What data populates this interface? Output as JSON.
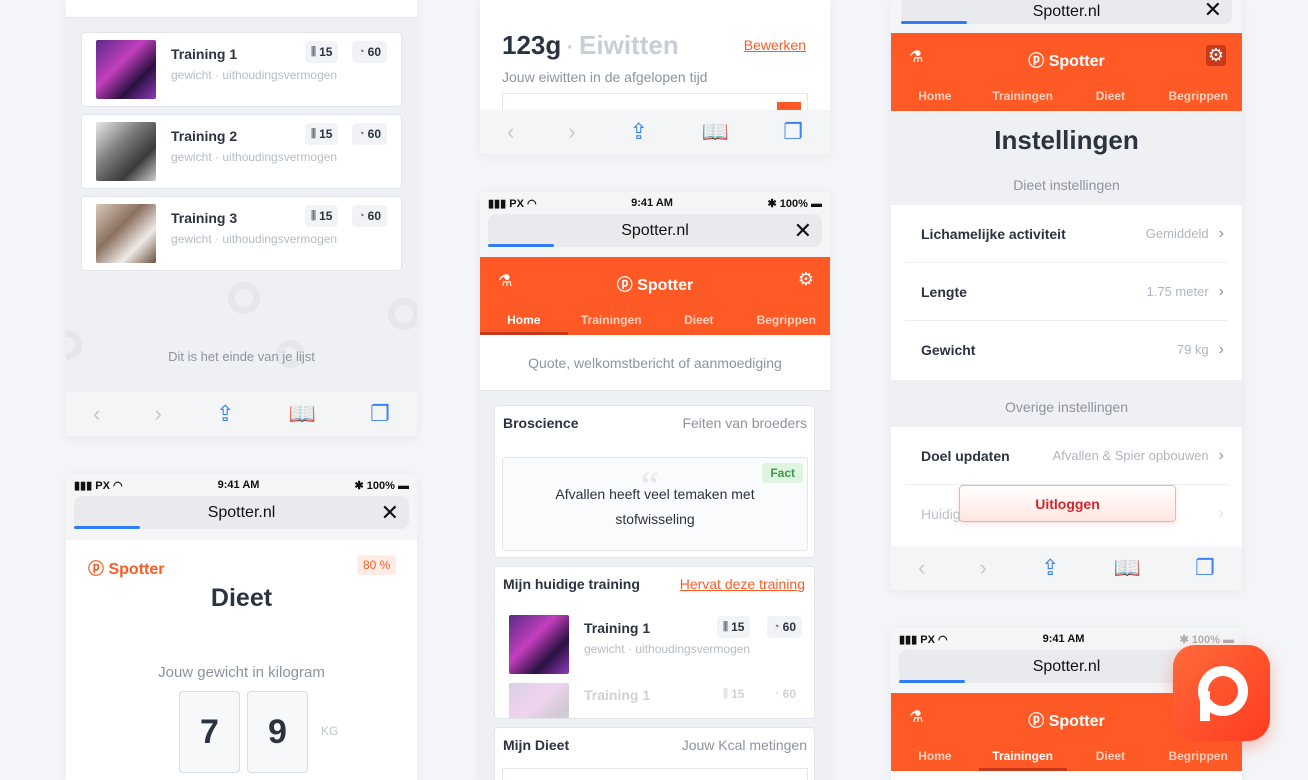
{
  "panel1": {
    "trainings": [
      {
        "name": "Training 1",
        "sub": "gewicht · uithoudingsvermogen",
        "sets": "15",
        "time": "60"
      },
      {
        "name": "Training 2",
        "sub": "gewicht · uithoudingsvermogen",
        "sets": "15",
        "time": "60"
      },
      {
        "name": "Training 3",
        "sub": "gewicht · uithoudingsvermogen",
        "sets": "15",
        "time": "60"
      }
    ],
    "end_text": "Dit is het einde van je lijst"
  },
  "panel2": {
    "status": {
      "carrier": "PX",
      "time": "9:41 AM",
      "battery": "100%"
    },
    "url": "Spotter.nl",
    "brand": "Spotter",
    "percent": "80 %",
    "title": "Dieet",
    "weight_label": "Jouw gewicht in kilogram",
    "digits": [
      "7",
      "9"
    ],
    "unit": "KG"
  },
  "panel3": {
    "protein_value": "123g",
    "protein_label": "Eiwitten",
    "edit": "Bewerken",
    "protein_sub": "Jouw eiwitten in de afgelopen tijd"
  },
  "panel4": {
    "status": {
      "carrier": "PX",
      "time": "9:41 AM",
      "battery": "100%"
    },
    "url": "Spotter.nl",
    "brand": "Spotter",
    "tabs": [
      "Home",
      "Trainingen",
      "Dieet",
      "Begrippen"
    ],
    "quote": "Quote, welkomstbericht of aanmoediging",
    "broscience": {
      "title": "Broscience",
      "sub": "Feiten van broeders",
      "fact_tag": "Fact",
      "fact_text": "Afvallen heeft veel temaken met stofwisseling"
    },
    "current": {
      "title": "Mijn huidige training",
      "action": "Hervat deze training",
      "name": "Training 1",
      "sub": "gewicht · uithoudingsvermogen",
      "sets": "15",
      "time": "60",
      "ghost_name": "Training 1",
      "ghost_sets": "15",
      "ghost_time": "60"
    },
    "diet": {
      "title": "Mijn Dieet",
      "sub": "Jouw Kcal metingen"
    }
  },
  "panel5": {
    "url": "Spotter.nl",
    "brand": "Spotter",
    "tabs": [
      "Home",
      "Trainingen",
      "Dieet",
      "Begrippen"
    ],
    "title": "Instellingen",
    "section1": "Dieet instellingen",
    "rows1": [
      {
        "label": "Lichamelijke activiteit",
        "value": "Gemiddeld"
      },
      {
        "label": "Lengte",
        "value": "1.75 meter"
      },
      {
        "label": "Gewicht",
        "value": "79 kg"
      }
    ],
    "section2": "Overige instellingen",
    "rows2": [
      {
        "label": "Doel updaten",
        "value": "Afvallen & Spier opbouwen"
      },
      {
        "label": "Huidig",
        "value": ""
      }
    ],
    "logout": "Uitloggen"
  },
  "panel6": {
    "status": {
      "carrier": "PX",
      "time": "9:41 AM",
      "battery": "100%"
    },
    "url": "Spotter.nl",
    "brand": "Spotter",
    "tabs": [
      "Home",
      "Trainingen",
      "Dieet",
      "Begrippen"
    ]
  },
  "colors": {
    "accent": "#ff5a26",
    "link": "#2f7cf6"
  }
}
